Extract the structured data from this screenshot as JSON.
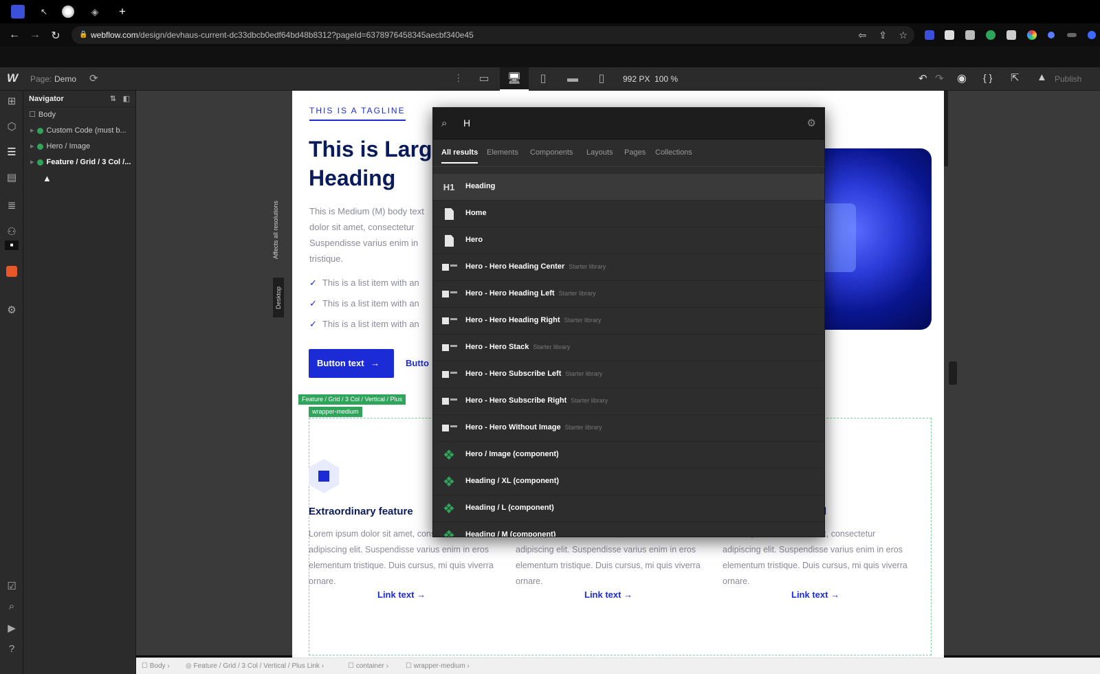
{
  "browser": {
    "url_host": "webflow.com",
    "url_path": "/design/devhaus-current-dc33dbcb0edf64bd48b8312?pageId=6378976458345aecbf340e45"
  },
  "designer": {
    "page_label": "Page:",
    "page_name": "Demo",
    "canvas_width": "992 PX",
    "zoom": "100 %",
    "publish_label": "Publish"
  },
  "navigator": {
    "title": "Navigator",
    "items": [
      {
        "label": "Body"
      },
      {
        "label": "Custom Code (must b..."
      },
      {
        "label": "Hero / Image"
      },
      {
        "label": "Feature / Grid / 3 Col /..."
      }
    ]
  },
  "page": {
    "tagline": "THIS IS A TAGLINE",
    "heading": "This is Large Heading",
    "body": "This is Medium (M) body text dolor sit amet, consectetur Suspendisse varius enim in tristique.",
    "list_items": [
      "This is a list item with an",
      "This is a list item with an",
      "This is a list item with an"
    ],
    "button_primary": "Button text",
    "button_secondary": "Butto",
    "selection_tag": "Feature / Grid / 3 Col / Vertical / Plus",
    "selection_tag2": "wrapper-medium",
    "affects_label": "Affects all resolutions",
    "breakpoint_tab": "Desktop",
    "features": [
      {
        "title": "Extraordinary feature",
        "body": "Lorem ipsum dolor sit amet, consectetur adipiscing elit. Suspendisse varius enim in eros elementum tristique. Duis cursus, mi quis viverra ornare.",
        "link": "Link text"
      },
      {
        "title": "",
        "body": "Lorem ipsum dolor sit amet, consectetur adipiscing elit. Suspendisse varius enim in eros elementum tristique. Duis cursus, mi quis viverra ornare.",
        "link": "Link text"
      },
      {
        "title": "ential",
        "body": "Lorem ipsum dolor sit amet, consectetur adipiscing elit. Suspendisse varius enim in eros elementum tristique. Duis cursus, mi quis viverra ornare.",
        "link": "Link text"
      }
    ]
  },
  "search": {
    "query": "H",
    "tabs": [
      "All results",
      "Elements",
      "Components",
      "Layouts",
      "Pages",
      "Collections"
    ],
    "results": [
      {
        "icon": "heading-icon",
        "label": "Heading",
        "sub": ""
      },
      {
        "icon": "page-icon",
        "label": "Home",
        "sub": ""
      },
      {
        "icon": "page-icon",
        "label": "Hero",
        "sub": ""
      },
      {
        "icon": "layout-icon",
        "label": "Hero - Hero Heading Center",
        "sub": "Starter library"
      },
      {
        "icon": "layout-icon",
        "label": "Hero - Hero Heading Left",
        "sub": "Starter library"
      },
      {
        "icon": "layout-icon",
        "label": "Hero - Hero Heading Right",
        "sub": "Starter library"
      },
      {
        "icon": "layout-icon",
        "label": "Hero - Hero Stack",
        "sub": "Starter library"
      },
      {
        "icon": "layout-icon",
        "label": "Hero - Hero Subscribe Left",
        "sub": "Starter library"
      },
      {
        "icon": "layout-icon",
        "label": "Hero - Hero Subscribe Right",
        "sub": "Starter library"
      },
      {
        "icon": "layout-icon",
        "label": "Hero - Hero Without Image",
        "sub": "Starter library"
      },
      {
        "icon": "component-icon",
        "label": "Hero / Image (component)",
        "sub": ""
      },
      {
        "icon": "component-icon",
        "label": "Heading / XL (component)",
        "sub": ""
      },
      {
        "icon": "component-icon",
        "label": "Heading / L (component)",
        "sub": ""
      },
      {
        "icon": "component-icon",
        "label": "Heading / M (component)",
        "sub": ""
      }
    ]
  },
  "breadcrumb": [
    "Body",
    "Feature / Grid / 3 Col / Vertical / Plus Link",
    "container",
    "wrapper-medium"
  ],
  "colors": {
    "accent": "#1b2bd6",
    "component": "#2fa55b",
    "panel": "#2b2b2b"
  }
}
